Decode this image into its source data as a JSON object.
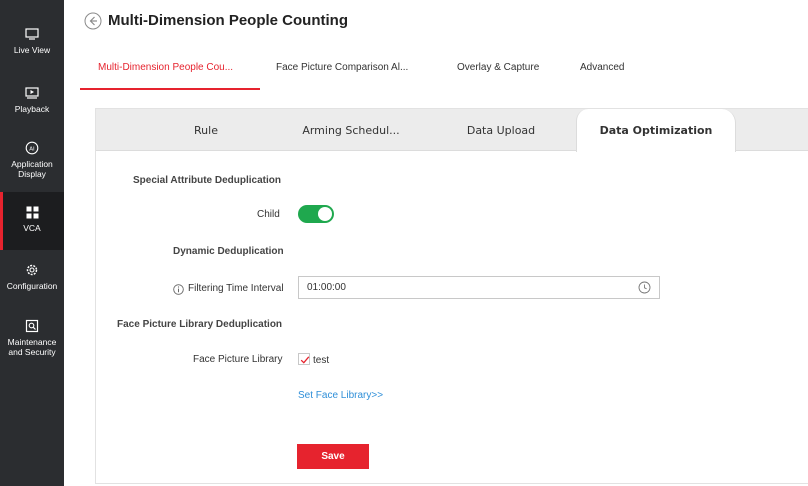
{
  "sidebar": {
    "items": [
      {
        "label": "Live View",
        "icon": "monitor-icon"
      },
      {
        "label": "Playback",
        "icon": "play-icon"
      },
      {
        "label": "Application Display",
        "icon": "ai-icon"
      },
      {
        "label": "VCA",
        "icon": "grid-icon"
      },
      {
        "label": "Configuration",
        "icon": "gear-icon"
      },
      {
        "label": "Maintenance and Security",
        "icon": "maintenance-icon"
      }
    ],
    "active": "VCA"
  },
  "header": {
    "title": "Multi-Dimension People Counting"
  },
  "top_tabs": [
    {
      "label": "Multi-Dimension People Cou..."
    },
    {
      "label": "Face Picture Comparison Al..."
    },
    {
      "label": "Overlay & Capture"
    },
    {
      "label": "Advanced"
    }
  ],
  "sub_tabs": [
    {
      "label": "Rule"
    },
    {
      "label": "Arming Schedul..."
    },
    {
      "label": "Data Upload"
    },
    {
      "label": "Data Optimization"
    }
  ],
  "form": {
    "special_attr_title": "Special Attribute Deduplication",
    "child_label": "Child",
    "child_enabled": true,
    "dynamic_title": "Dynamic Deduplication",
    "filter_label": "Filtering Time Interval",
    "filter_value": "01:00:00",
    "face_lib_title": "Face Picture Library Deduplication",
    "face_lib_label": "Face Picture Library",
    "face_lib_option": "test",
    "face_lib_checked": true,
    "set_link": "Set Face Library>>",
    "save_label": "Save"
  },
  "colors": {
    "accent": "#e6232e",
    "toggle_on": "#1fa84e",
    "link": "#2f8fd8",
    "sidebar_bg": "#2b2d30"
  }
}
